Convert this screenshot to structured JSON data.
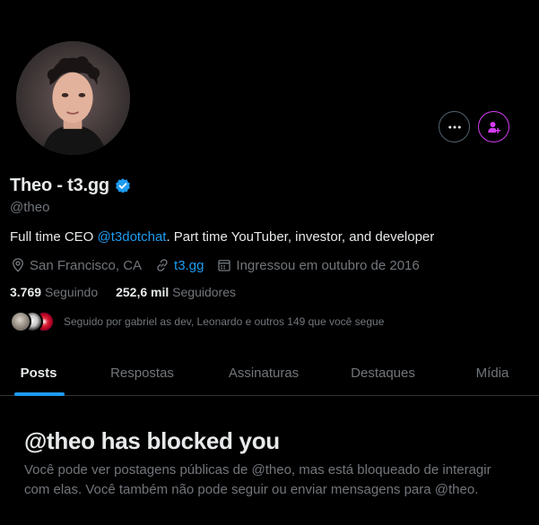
{
  "profile": {
    "display_name": "Theo - t3.gg",
    "handle": "@theo",
    "bio_prefix": "Full time CEO ",
    "bio_mention": "@t3dotchat",
    "bio_suffix": ". Part time YouTuber, investor, and developer",
    "location": "San Francisco, CA",
    "website": "t3.gg",
    "joined": "Ingressou em outubro de 2016",
    "following_count": "3.769",
    "following_label": "Seguindo",
    "followers_count": "252,6 mil",
    "followers_label": "Seguidores",
    "followed_by": "Seguido por gabriel as dev, Leonardo e outros 149 que você segue"
  },
  "actions": {
    "more_icon": "more-horizontal-icon",
    "follow_icon": "person-plus-icon"
  },
  "tabs": [
    {
      "label": "Posts",
      "active": true
    },
    {
      "label": "Respostas",
      "active": false
    },
    {
      "label": "Assinaturas",
      "active": false
    },
    {
      "label": "Destaques",
      "active": false
    },
    {
      "label": "Mídia",
      "active": false
    }
  ],
  "blocked": {
    "title": "@theo has blocked you",
    "message": "Você pode ver postagens públicas de @theo, mas está bloqueado de interagir com elas. Você também não pode seguir ou enviar mensagens para @theo."
  },
  "colors": {
    "background": "#000000",
    "text_primary": "#e7e9ea",
    "text_secondary": "#71767b",
    "accent_blue": "#1d9bf0",
    "accent_purple": "#d63cf4",
    "border": "#2f3336"
  }
}
